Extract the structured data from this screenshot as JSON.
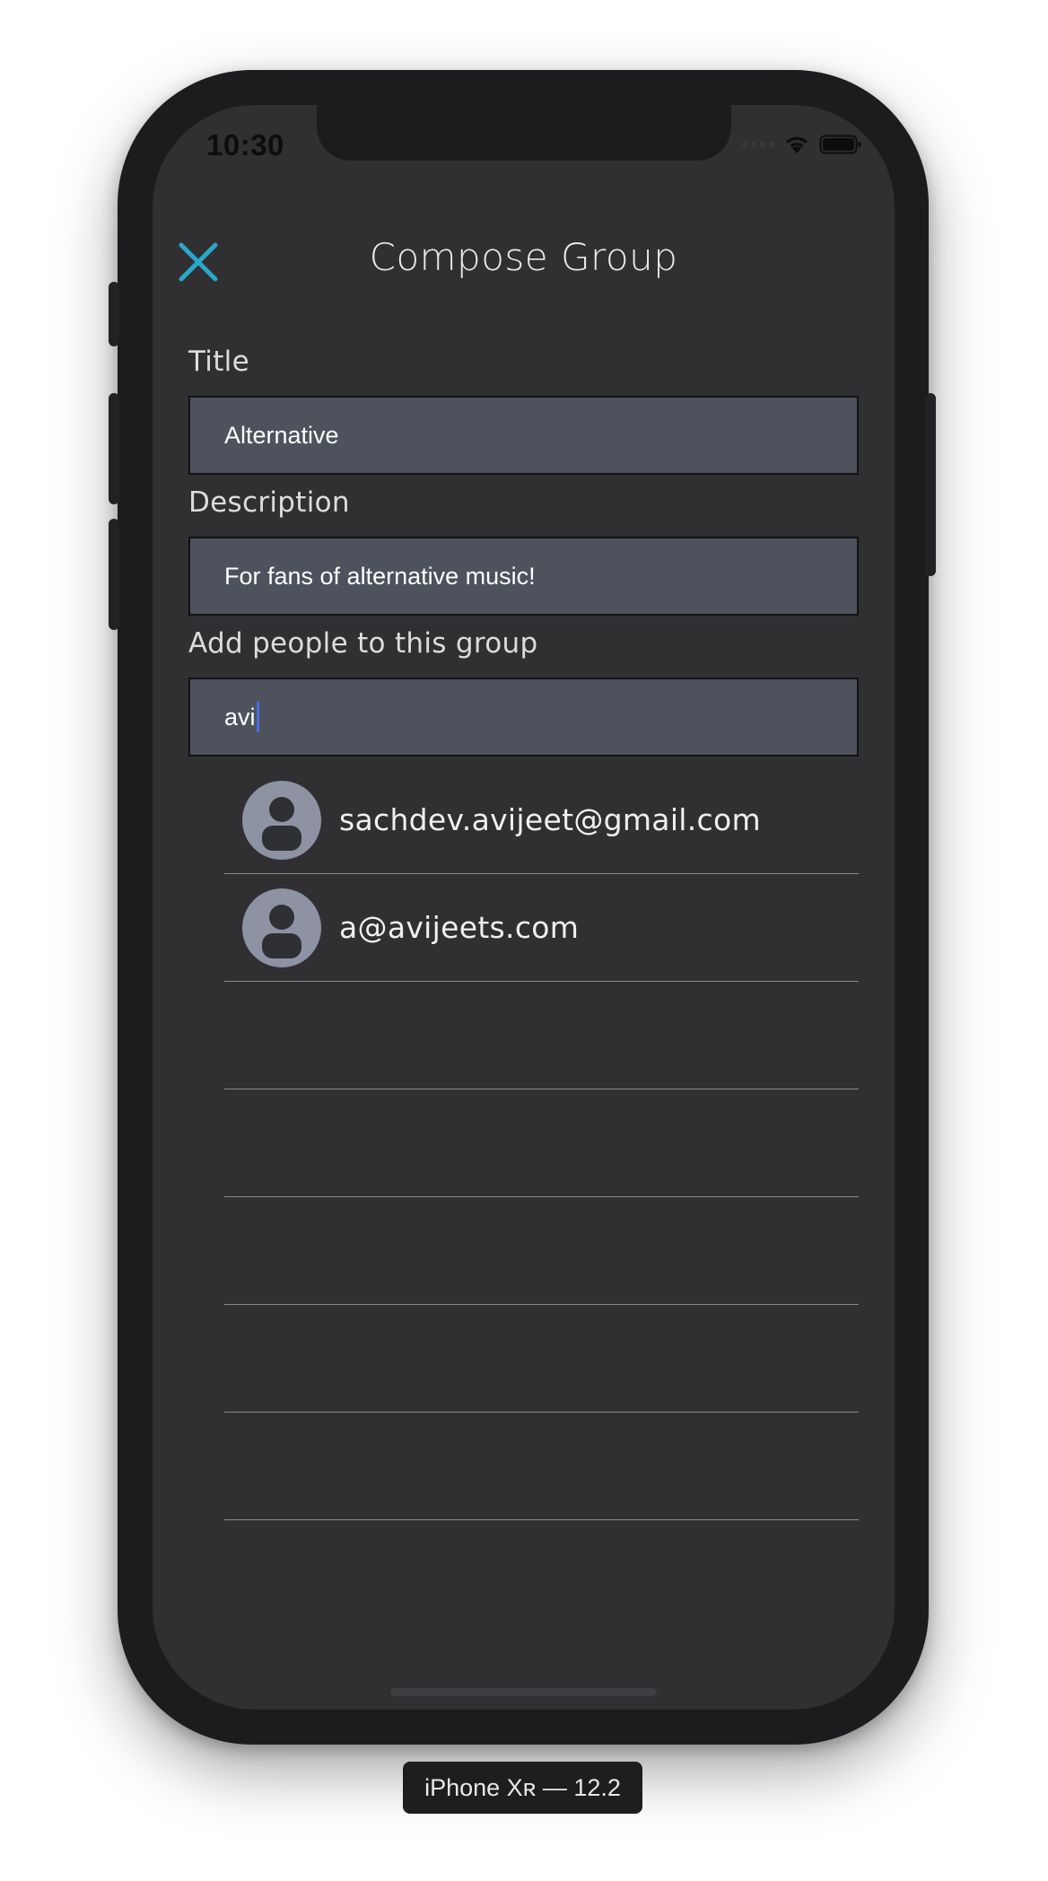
{
  "status_bar": {
    "time": "10:30"
  },
  "header": {
    "title": "Compose Group",
    "close_icon": "close-icon",
    "accent_color": "#2aa8c9"
  },
  "form": {
    "title_label": "Title",
    "title_value": "Alternative",
    "description_label": "Description",
    "description_value": "For fans of alternative music!",
    "people_label": "Add people to this group",
    "people_search_value": "avi"
  },
  "suggestions": [
    {
      "email": "sachdev.avijeet@gmail.com",
      "icon": "avatar-placeholder-icon"
    },
    {
      "email": "a@avijeets.com",
      "icon": "avatar-placeholder-icon"
    }
  ],
  "simulator": {
    "device_label": "iPhone Xʀ — 12.2"
  }
}
